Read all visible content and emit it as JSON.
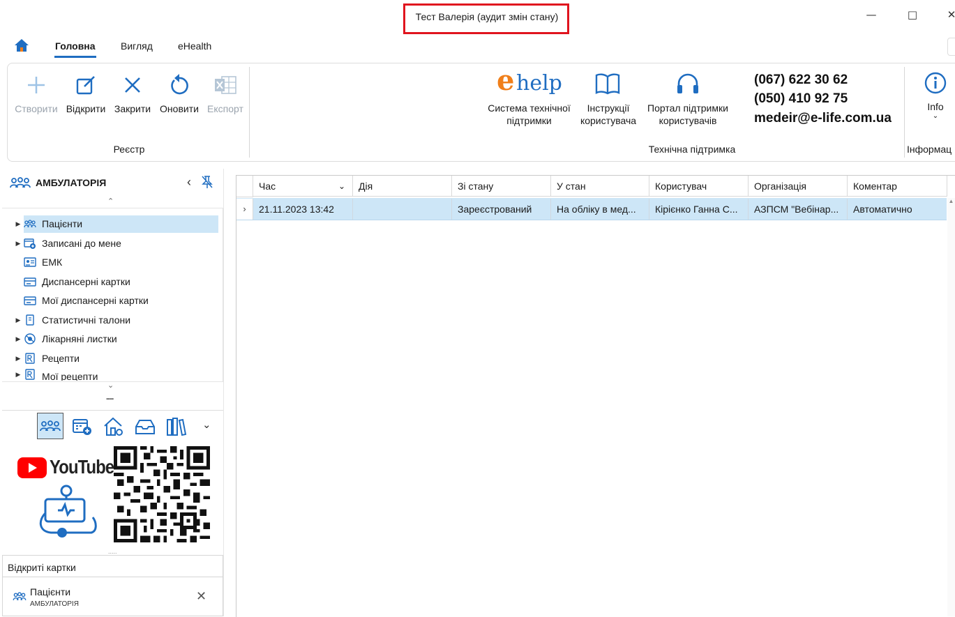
{
  "window": {
    "title": "Тест Валерія (аудит змін стану)"
  },
  "tabs": [
    {
      "label": "Головна"
    },
    {
      "label": "Вигляд"
    },
    {
      "label": "eHealth"
    }
  ],
  "ribbon": {
    "registry": {
      "buttons": [
        {
          "label": "Створити",
          "icon": "plus-icon"
        },
        {
          "label": "Відкрити",
          "icon": "edit-icon"
        },
        {
          "label": "Закрити",
          "icon": "close-icon"
        },
        {
          "label": "Оновити",
          "icon": "refresh-icon"
        },
        {
          "label": "Експорт",
          "icon": "excel-icon"
        }
      ],
      "group_label": "Реєстр"
    },
    "support": {
      "logo_e": "e",
      "logo_help": "help",
      "buttons": [
        {
          "label1": "Система технічної",
          "label2": "підтримки"
        },
        {
          "label1": "Інструкції",
          "label2": "користувача"
        },
        {
          "label1": "Портал підтримки",
          "label2": "користувачів"
        }
      ],
      "phone1": "(067) 622 30 62",
      "phone2": "(050) 410 92 75",
      "email": "medeir@e-life.com.ua",
      "group_label": "Технічна підтримка"
    },
    "info": {
      "label": "Info",
      "group_label": "Інформац"
    }
  },
  "sidebar": {
    "title": "АМБУЛАТОРІЯ",
    "items": [
      {
        "label": "Пацієнти",
        "expandable": true
      },
      {
        "label": "Записані до мене",
        "expandable": true
      },
      {
        "label": "ЕМК",
        "expandable": false
      },
      {
        "label": "Диспансерні картки",
        "expandable": false
      },
      {
        "label": "Мої диспансерні картки",
        "expandable": false
      },
      {
        "label": "Статистичні талони",
        "expandable": true
      },
      {
        "label": "Лікарняні листки",
        "expandable": true
      },
      {
        "label": "Рецепти",
        "expandable": true
      },
      {
        "label": "Мої рецепти",
        "expandable": true
      }
    ],
    "banner_youtube": "YouTube",
    "open_cards": {
      "header": "Відкриті картки",
      "card_title": "Пацієнти",
      "card_subtitle": "АМБУЛАТОРІЯ"
    }
  },
  "grid": {
    "columns": [
      "Час",
      "Дія",
      "Зі стану",
      "У стан",
      "Користувач",
      "Організація",
      "Коментар"
    ],
    "rows": [
      [
        "21.11.2023 13:42",
        "",
        "Зареєстрований",
        "На обліку в мед...",
        "Кірієнко Ганна С...",
        "АЗПСМ \"Вебінар...",
        "Автоматично"
      ]
    ]
  },
  "colors": {
    "accent": "#1f6dc1",
    "selection": "#cde6f7",
    "highlight_box": "#e0141e",
    "ehelp_orange": "#f07f1a",
    "youtube_red": "#ff0000"
  }
}
